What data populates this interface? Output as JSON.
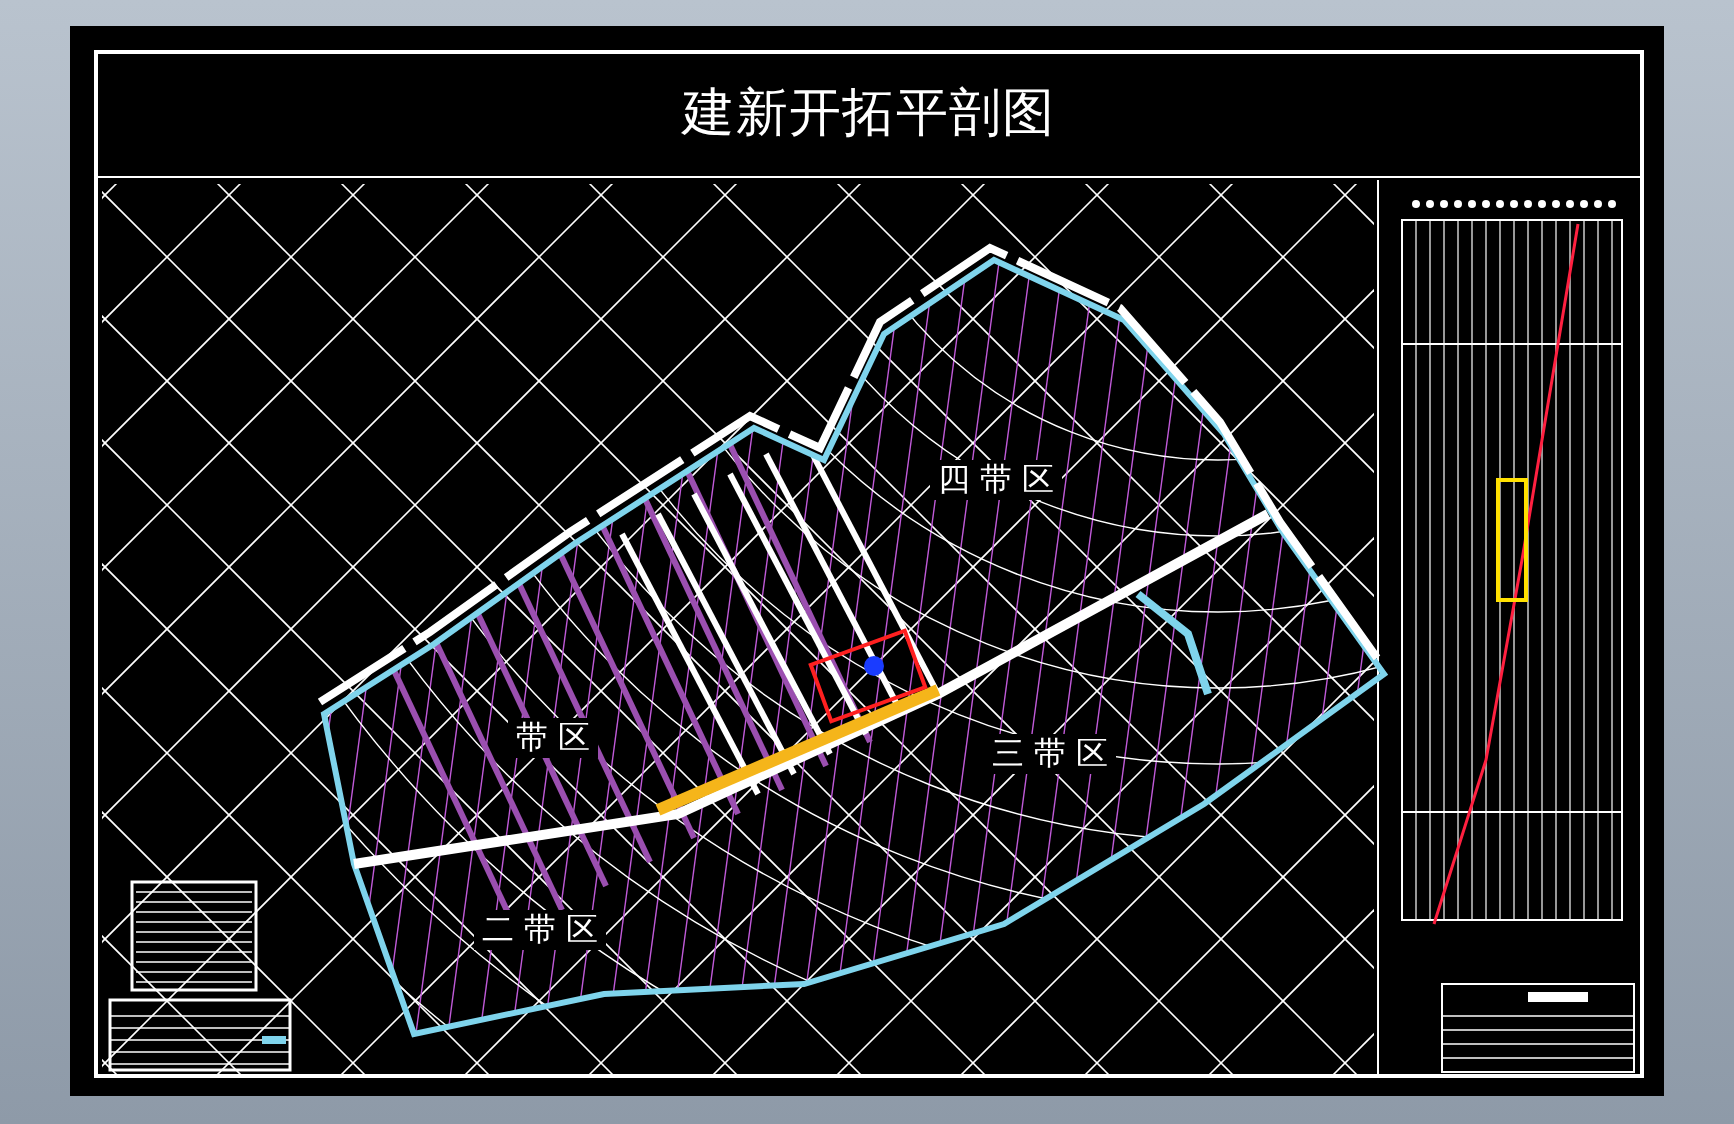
{
  "drawing": {
    "title": "建新开拓平剖图",
    "zone_labels": [
      "四 带 区",
      "三 带 区",
      "二 带 区",
      "带 区"
    ]
  }
}
